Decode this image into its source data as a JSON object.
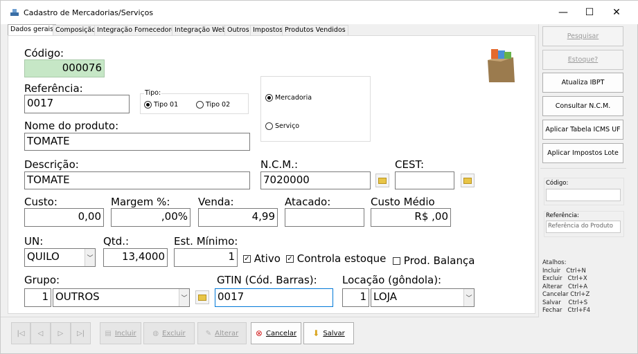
{
  "window": {
    "title": "Cadastro de Mercadorias/Serviços",
    "minimize": "—",
    "maximize": "☐",
    "close": "✕"
  },
  "tabs": [
    "Dados gerais",
    "Composição",
    "Integração Fornecedores",
    "Integração Web",
    "Outros",
    "Impostos",
    "Produtos Vendidos"
  ],
  "form": {
    "codigo_label": "Código:",
    "codigo_value": "000076",
    "referencia_label": "Referência:",
    "referencia_value": "0017",
    "tipo_label": "Tipo:",
    "tipo1": "Tipo 01",
    "tipo2": "Tipo 02",
    "mercadoria": "Mercadoria",
    "servico": "Serviço",
    "nome_label": "Nome do produto:",
    "nome_value": "TOMATE",
    "descricao_label": "Descrição:",
    "descricao_value": "TOMATE",
    "ncm_label": "N.C.M.:",
    "ncm_value": "7020000",
    "cest_label": "CEST:",
    "cest_value": "",
    "custo_label": "Custo:",
    "custo_value": "0,00",
    "margem_label": "Margem %:",
    "margem_value": ",00%",
    "venda_label": "Venda:",
    "venda_value": "4,99",
    "atacado_label": "Atacado:",
    "atacado_value": "",
    "custo_medio_label": "Custo Médio",
    "custo_medio_value": "R$ ,00",
    "un_label": "UN:",
    "un_value": "QUILO",
    "qtd_label": "Qtd.:",
    "qtd_value": "13,4000",
    "est_min_label": "Est. Mínimo:",
    "est_min_value": "1",
    "ativo_label": "Ativo",
    "controla_label": "Controla estoque",
    "balanca_label": "Prod. Balança",
    "grupo_label": "Grupo:",
    "grupo_code": "1",
    "grupo_value": "OUTROS",
    "gtin_label": "GTIN (Cód. Barras):",
    "gtin_value": "0017",
    "locacao_label": "Locação (gôndola):",
    "locacao_code": "1",
    "locacao_value": "LOJA"
  },
  "side": {
    "pesquisar": "Pesquisar",
    "estoque": "Estoque?",
    "atualiza_ibpt": "Atualiza IBPT",
    "consultar_ncm": "Consultar N.C.M.",
    "aplicar_icms": "Aplicar Tabela ICMS UF",
    "aplicar_impostos": "Aplicar Impostos Lote",
    "codigo_label": "Código:",
    "codigo_value": "",
    "referencia_label": "Referência:",
    "referencia_placeholder": "Referência do Produto",
    "atalhos": "Atalhos:\nIncluir   Ctrl+N\nExcluir   Ctrl+X\nAlterar   Ctrl+A\nCancelar Ctrl+Z\nSalvar    Ctrl+S\nFechar   Ctrl+F4"
  },
  "toolbar": {
    "first": "|◁",
    "prev": "◁",
    "next": "▷",
    "last": "▷|",
    "incluir": "Incluir",
    "excluir": "Excluir",
    "alterar": "Alterar",
    "cancelar": "Cancelar",
    "salvar": "Salvar"
  },
  "colors": {
    "codigo_bg": "#c6e7c6",
    "focus_border": "#0078d7",
    "disabled_text": "#9a9a9a"
  }
}
